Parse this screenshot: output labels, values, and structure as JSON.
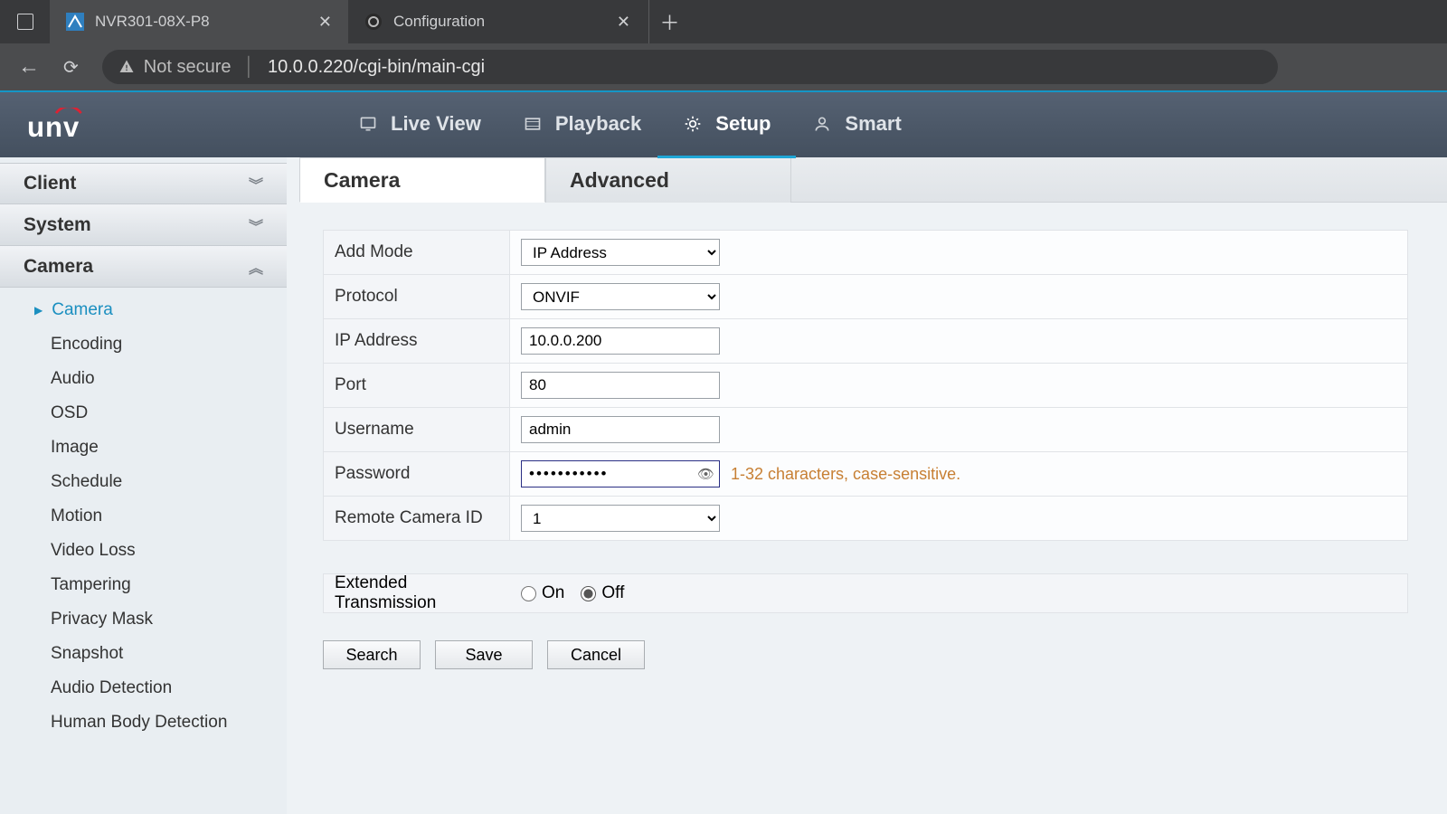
{
  "browser": {
    "tabs": [
      {
        "title": "NVR301-08X-P8",
        "active": true
      },
      {
        "title": "Configuration",
        "active": false
      }
    ],
    "security_label": "Not secure",
    "url": "10.0.0.220/cgi-bin/main-cgi"
  },
  "nav": {
    "live_view": "Live View",
    "playback": "Playback",
    "setup": "Setup",
    "smart": "Smart"
  },
  "sidebar": {
    "sections": {
      "client": "Client",
      "system": "System",
      "camera": "Camera"
    },
    "camera_items": [
      "Camera",
      "Encoding",
      "Audio",
      "OSD",
      "Image",
      "Schedule",
      "Motion",
      "Video Loss",
      "Tampering",
      "Privacy Mask",
      "Snapshot",
      "Audio Detection",
      "Human Body Detection"
    ]
  },
  "tabs": {
    "camera": "Camera",
    "advanced": "Advanced"
  },
  "form": {
    "add_mode_label": "Add Mode",
    "add_mode_value": "IP Address",
    "protocol_label": "Protocol",
    "protocol_value": "ONVIF",
    "ip_label": "IP Address",
    "ip_value": "10.0.0.200",
    "port_label": "Port",
    "port_value": "80",
    "user_label": "Username",
    "user_value": "admin",
    "pw_label": "Password",
    "pw_value": "•••••••••••",
    "pw_hint": "1-32 characters, case-sensitive.",
    "remote_id_label": "Remote Camera ID",
    "remote_id_value": "1",
    "ext_label": "Extended Transmission",
    "ext_on": "On",
    "ext_off": "Off"
  },
  "buttons": {
    "search": "Search",
    "save": "Save",
    "cancel": "Cancel"
  }
}
